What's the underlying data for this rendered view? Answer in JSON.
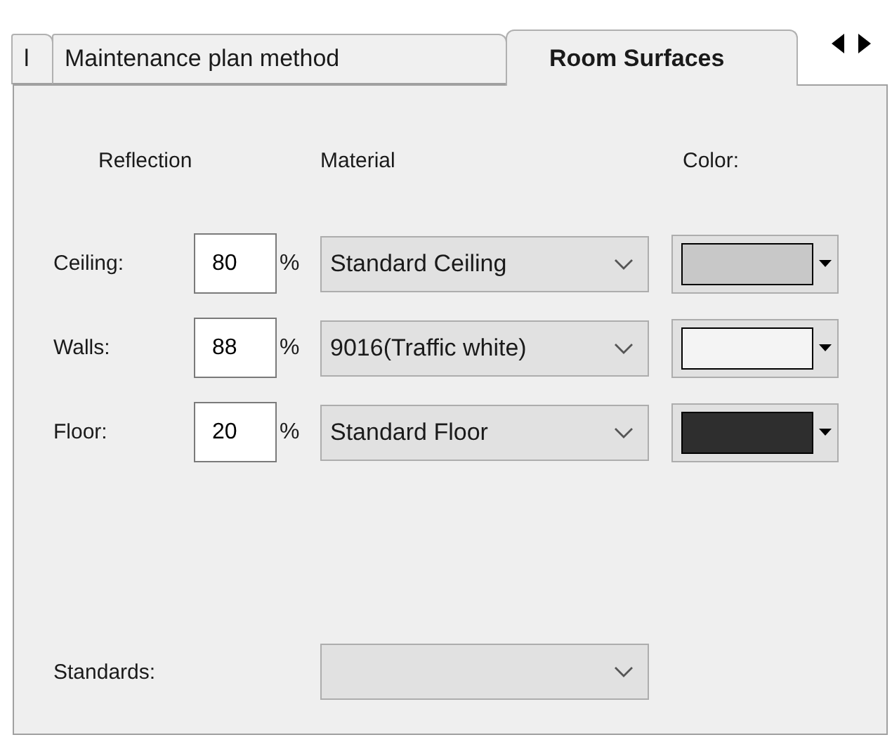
{
  "tabs": [
    {
      "label": "l",
      "selected": false
    },
    {
      "label": "Maintenance plan method",
      "selected": false
    },
    {
      "label": "Room Surfaces",
      "selected": true
    }
  ],
  "headers": {
    "reflection": "Reflection",
    "material": "Material",
    "color_label": "Color:"
  },
  "surfaces": [
    {
      "label": "Ceiling:",
      "reflection": "80",
      "unit": "%",
      "material": "Standard Ceiling",
      "color": "#c8c8c8"
    },
    {
      "label": "Walls:",
      "reflection": "88",
      "unit": "%",
      "material": "9016(Traffic white)",
      "color": "#f4f4f4"
    },
    {
      "label": "Floor:",
      "reflection": "20",
      "unit": "%",
      "material": "Standard Floor",
      "color": "#2e2e2e"
    }
  ],
  "standards": {
    "label": "Standards:",
    "disabled": true
  }
}
